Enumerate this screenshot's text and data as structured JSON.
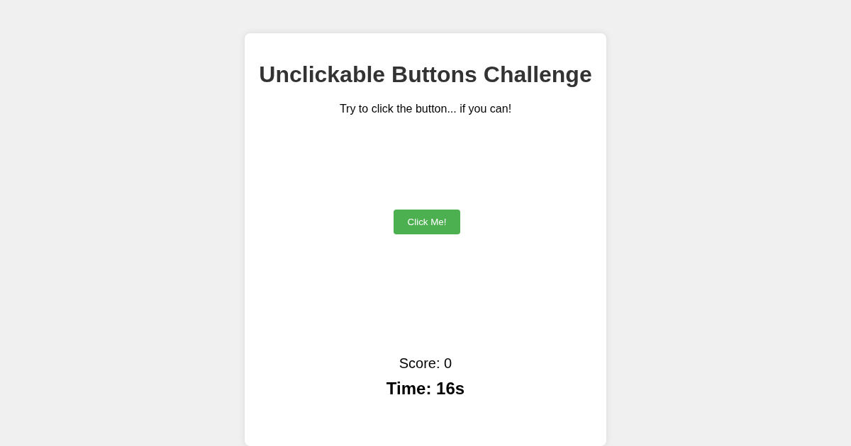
{
  "title": "Unclickable Buttons Challenge",
  "instructions": "Try to click the button... if you can!",
  "button": {
    "label": "Click Me!"
  },
  "score": "Score: 0",
  "time": "Time: 16s"
}
